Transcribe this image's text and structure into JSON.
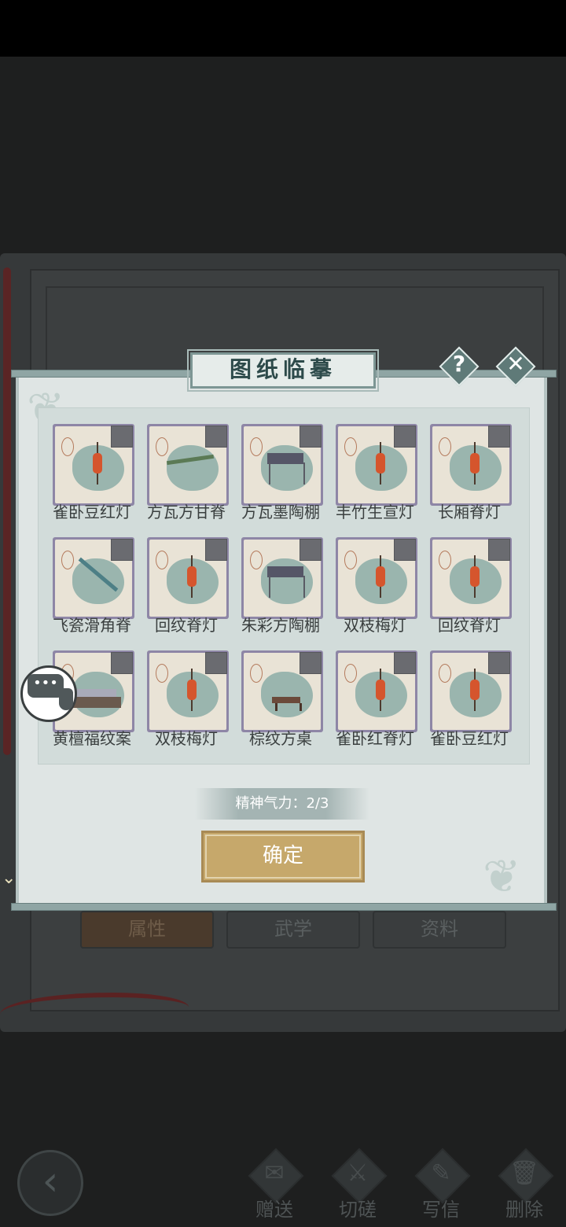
{
  "background": {
    "tabs": [
      {
        "label": "属性",
        "active": true
      },
      {
        "label": "武学",
        "active": false
      },
      {
        "label": "资料",
        "active": false
      }
    ]
  },
  "toolbar": {
    "items": [
      {
        "label": "赠送",
        "icon": "gift-scroll-icon"
      },
      {
        "label": "切磋",
        "icon": "sword-icon"
      },
      {
        "label": "写信",
        "icon": "letter-icon"
      },
      {
        "label": "删除",
        "icon": "trash-icon"
      }
    ]
  },
  "modal": {
    "title": "图纸临摹",
    "items": [
      {
        "name": "雀卧豆红灯",
        "icon": "red-lantern-icon"
      },
      {
        "name": "方瓦方甘脊",
        "icon": "bamboo-poles-icon"
      },
      {
        "name": "方瓦墨陶棚",
        "icon": "shed-icon"
      },
      {
        "name": "丰竹生宣灯",
        "icon": "paper-lantern-icon"
      },
      {
        "name": "长厢脊灯",
        "icon": "ridge-lantern-icon"
      },
      {
        "name": "飞瓷滑角脊",
        "icon": "slide-ridge-icon"
      },
      {
        "name": "回纹脊灯",
        "icon": "ridge-lantern-icon"
      },
      {
        "name": "朱彩方陶棚",
        "icon": "shed-icon"
      },
      {
        "name": "双枝梅灯",
        "icon": "red-lantern-icon"
      },
      {
        "name": "回纹脊灯",
        "icon": "ridge-lantern-icon"
      },
      {
        "name": "黄檀福纹案",
        "icon": "desk-icon"
      },
      {
        "name": "双枝梅灯",
        "icon": "red-lantern-icon"
      },
      {
        "name": "棕纹方桌",
        "icon": "table-icon"
      },
      {
        "name": "雀卧红脊灯",
        "icon": "red-lantern-icon"
      },
      {
        "name": "雀卧豆红灯",
        "icon": "red-lantern-icon"
      }
    ],
    "energy_label": "精神气力：2/3",
    "confirm_label": "确定"
  },
  "colors": {
    "accent_gold": "#c6a86b",
    "modal_bg": "#dfe5e4",
    "frame_purple": "#8e86a6"
  }
}
